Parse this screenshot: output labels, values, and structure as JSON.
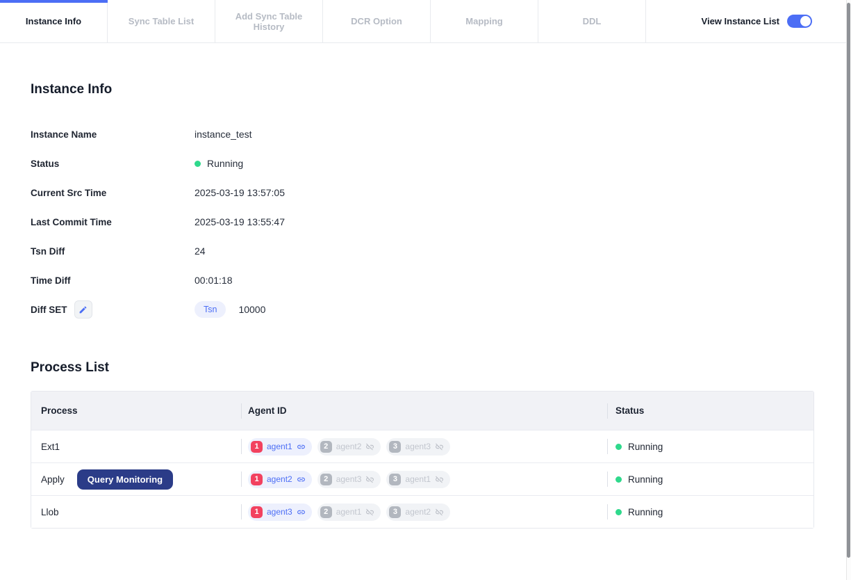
{
  "tabs": [
    {
      "label": "Instance Info",
      "active": true
    },
    {
      "label": "Sync Table List",
      "active": false
    },
    {
      "label": "Add Sync Table History",
      "active": false
    },
    {
      "label": "DCR Option",
      "active": false
    },
    {
      "label": "Mapping",
      "active": false
    },
    {
      "label": "DDL",
      "active": false
    }
  ],
  "view_instance_list": {
    "label": "View Instance List",
    "enabled": true
  },
  "instance_info": {
    "title": "Instance Info",
    "fields": [
      {
        "label": "Instance Name",
        "value": "instance_test"
      },
      {
        "label": "Status",
        "value": "Running",
        "status_color": "#2fd98c"
      },
      {
        "label": "Current Src Time",
        "value": "2025-03-19 13:57:05"
      },
      {
        "label": "Last Commit Time",
        "value": "2025-03-19 13:55:47"
      },
      {
        "label": "Tsn Diff",
        "value": "24"
      },
      {
        "label": "Time Diff",
        "value": "00:01:18"
      },
      {
        "label": "Diff SET",
        "badge": "Tsn",
        "value": "10000"
      }
    ]
  },
  "process_list": {
    "title": "Process List",
    "columns": [
      "Process",
      "Agent ID",
      "Status"
    ],
    "rows": [
      {
        "process": "Ext1",
        "agents": [
          {
            "num": "1",
            "name": "agent1",
            "linked": true
          },
          {
            "num": "2",
            "name": "agent2",
            "linked": false
          },
          {
            "num": "3",
            "name": "agent3",
            "linked": false
          }
        ],
        "status": "Running"
      },
      {
        "process": "Apply",
        "button": "Query Monitoring",
        "agents": [
          {
            "num": "1",
            "name": "agent2",
            "linked": true
          },
          {
            "num": "2",
            "name": "agent3",
            "linked": false
          },
          {
            "num": "3",
            "name": "agent1",
            "linked": false
          }
        ],
        "status": "Running"
      },
      {
        "process": "Llob",
        "agents": [
          {
            "num": "1",
            "name": "agent3",
            "linked": true
          },
          {
            "num": "2",
            "name": "agent1",
            "linked": false
          },
          {
            "num": "3",
            "name": "agent2",
            "linked": false
          }
        ],
        "status": "Running"
      }
    ]
  },
  "colors": {
    "accent_blue": "#4c6ef5",
    "active_tab_underline": "#4c6ef5",
    "status_green": "#2fd98c",
    "agent_primary_red": "#f2415f",
    "agent_muted_gray": "#b2b7bf",
    "query_button_navy": "#2b3c88",
    "badge_lavender_bg": "#edf0fd",
    "badge_gray_bg": "#f1f3f6",
    "table_header_bg": "#f1f2f6"
  }
}
